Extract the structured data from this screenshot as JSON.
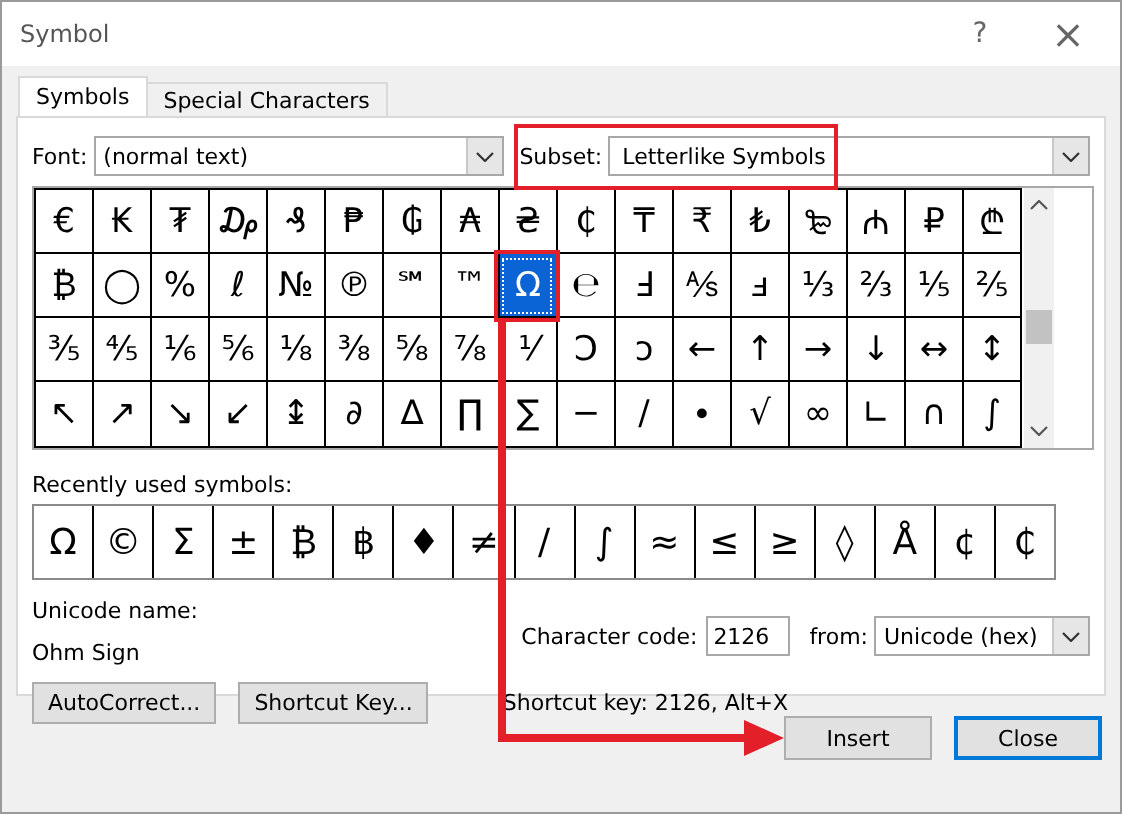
{
  "window": {
    "title": "Symbol",
    "help": "?",
    "close": "×"
  },
  "tabs": [
    {
      "label": "Symbols",
      "selected": true
    },
    {
      "label": "Special Characters",
      "selected": false
    }
  ],
  "font": {
    "label": "Font:",
    "value": "(normal text)"
  },
  "subset": {
    "label": "Subset:",
    "value": "Letterlike Symbols"
  },
  "grid": [
    [
      {
        "char": "€",
        "selected": false
      },
      {
        "char": "₭",
        "selected": false
      },
      {
        "char": "₮",
        "selected": false
      },
      {
        "char": "₯",
        "selected": false
      },
      {
        "char": "₰",
        "selected": false
      },
      {
        "char": "₱",
        "selected": false
      },
      {
        "char": "₲",
        "selected": false
      },
      {
        "char": "₳",
        "selected": false
      },
      {
        "char": "₴",
        "selected": false
      },
      {
        "char": "₵",
        "selected": false
      },
      {
        "char": "₸",
        "selected": false
      },
      {
        "char": "₹",
        "selected": false
      },
      {
        "char": "₺",
        "selected": false
      },
      {
        "char": "₻",
        "selected": false
      },
      {
        "char": "₼",
        "selected": false
      },
      {
        "char": "₽",
        "selected": false
      },
      {
        "char": "₾",
        "selected": false
      }
    ],
    [
      {
        "char": "₿",
        "selected": false
      },
      {
        "char": "◯",
        "selected": false
      },
      {
        "char": "%",
        "selected": false
      },
      {
        "char": "ℓ",
        "selected": false
      },
      {
        "char": "№",
        "selected": false
      },
      {
        "char": "℗",
        "selected": false
      },
      {
        "char": "℠",
        "selected": false
      },
      {
        "char": "™",
        "selected": false
      },
      {
        "char": "Ω",
        "selected": true
      },
      {
        "char": "℮",
        "selected": false
      },
      {
        "char": "Ⅎ",
        "selected": false
      },
      {
        "char": "⅍",
        "selected": false
      },
      {
        "char": "ⅎ",
        "selected": false
      },
      {
        "char": "⅓",
        "selected": false
      },
      {
        "char": "⅔",
        "selected": false
      },
      {
        "char": "⅕",
        "selected": false
      },
      {
        "char": "⅖",
        "selected": false
      }
    ],
    [
      {
        "char": "⅗",
        "selected": false
      },
      {
        "char": "⅘",
        "selected": false
      },
      {
        "char": "⅙",
        "selected": false
      },
      {
        "char": "⅚",
        "selected": false
      },
      {
        "char": "⅛",
        "selected": false
      },
      {
        "char": "⅜",
        "selected": false
      },
      {
        "char": "⅝",
        "selected": false
      },
      {
        "char": "⅞",
        "selected": false
      },
      {
        "char": "⅟",
        "selected": false
      },
      {
        "char": "Ↄ",
        "selected": false
      },
      {
        "char": "ↄ",
        "selected": false
      },
      {
        "char": "←",
        "selected": false
      },
      {
        "char": "↑",
        "selected": false
      },
      {
        "char": "→",
        "selected": false
      },
      {
        "char": "↓",
        "selected": false
      },
      {
        "char": "↔",
        "selected": false
      },
      {
        "char": "↕",
        "selected": false
      }
    ],
    [
      {
        "char": "↖",
        "selected": false
      },
      {
        "char": "↗",
        "selected": false
      },
      {
        "char": "↘",
        "selected": false
      },
      {
        "char": "↙",
        "selected": false
      },
      {
        "char": "↨",
        "selected": false
      },
      {
        "char": "∂",
        "selected": false
      },
      {
        "char": "∆",
        "selected": false
      },
      {
        "char": "∏",
        "selected": false
      },
      {
        "char": "∑",
        "selected": false
      },
      {
        "char": "−",
        "selected": false
      },
      {
        "char": "∕",
        "selected": false
      },
      {
        "char": "∙",
        "selected": false
      },
      {
        "char": "√",
        "selected": false
      },
      {
        "char": "∞",
        "selected": false
      },
      {
        "char": "∟",
        "selected": false
      },
      {
        "char": "∩",
        "selected": false
      },
      {
        "char": "∫",
        "selected": false
      }
    ]
  ],
  "recent": {
    "label": "Recently used symbols:",
    "symbols": [
      "Ω",
      "©",
      "Σ",
      "±",
      "₿",
      "฿",
      "♦",
      "≠",
      "/",
      "∫",
      "≈",
      "≤",
      "≥",
      "◊",
      "Å",
      "¢",
      "₵"
    ]
  },
  "unicode_name": {
    "label": "Unicode name:",
    "value": "Ohm Sign"
  },
  "character_code": {
    "label": "Character code:",
    "value": "2126"
  },
  "from": {
    "label": "from:",
    "value": "Unicode (hex)"
  },
  "buttons": [
    "AutoCorrect...",
    "Shortcut Key..."
  ],
  "shortcut_text": "Shortcut key: 2126, Alt+X",
  "footer_buttons": [
    {
      "label": "Insert",
      "default": false
    },
    {
      "label": "Close",
      "default": true
    }
  ]
}
